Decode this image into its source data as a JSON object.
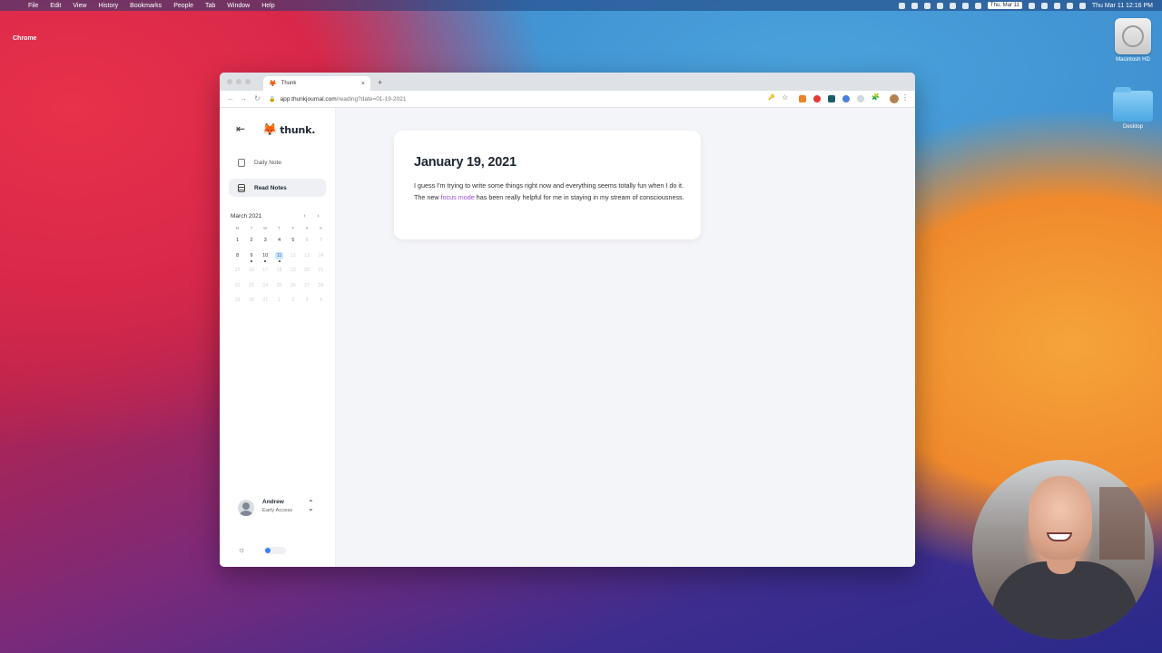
{
  "menubar": {
    "apple_glyph": "",
    "items": [
      "Chrome",
      "File",
      "Edit",
      "View",
      "History",
      "Bookmarks",
      "People",
      "Tab",
      "Window",
      "Help"
    ],
    "date_badge": "Thu, Mar 11",
    "clock": "Thu Mar 11  12:16 PM"
  },
  "desktop": {
    "hd_label": "Macintosh HD",
    "folder_label": "Desktop"
  },
  "browser": {
    "tab_title": "Thunk",
    "tab_close": "×",
    "new_tab": "+",
    "url_domain": "app.thunkjournal.com",
    "url_path": "/reading?date=01-19-2021",
    "back": "←",
    "forward": "→",
    "reload": "↻",
    "key_icon": "🔑",
    "star_icon": "☆",
    "puzzle_icon": "🧩",
    "kebab": "⋮"
  },
  "sidebar": {
    "collapse_icon": "⇤",
    "logo_text": "thunk.",
    "logo_fox": "🦊",
    "nav": [
      {
        "label": "Daily Note",
        "active": false
      },
      {
        "label": "Read Notes",
        "active": true
      }
    ],
    "calendar": {
      "month": "March 2021",
      "prev": "‹",
      "next": "›",
      "weekdays": [
        "M",
        "T",
        "W",
        "T",
        "F",
        "S",
        "S"
      ],
      "weeks": [
        [
          "1",
          "2",
          "3",
          "4",
          "5",
          "6",
          "7"
        ],
        [
          "8",
          "9",
          "10",
          "11",
          "12",
          "13",
          "14"
        ],
        [
          "15",
          "16",
          "17",
          "18",
          "19",
          "20",
          "21"
        ],
        [
          "22",
          "23",
          "24",
          "25",
          "26",
          "27",
          "28"
        ],
        [
          "29",
          "30",
          "31",
          "1",
          "2",
          "3",
          "4"
        ]
      ],
      "today": "11"
    },
    "user": {
      "name": "Andrew",
      "plan": "Early Access",
      "switch_icon": "⌃⌄"
    },
    "theme_icon": "☼"
  },
  "note": {
    "date_title": "January 19, 2021",
    "body_before": "I guess I'm trying to write some things right now and everything seems totally fun when I do it. The new ",
    "link_text": "focus mode",
    "body_after": " has been really helpful for me in staying in my stream of consciousness."
  },
  "colors": {
    "accent_link": "#9b4fd8",
    "today_highlight": "#cfe6fb",
    "toggle_knob": "#3b82f6"
  }
}
